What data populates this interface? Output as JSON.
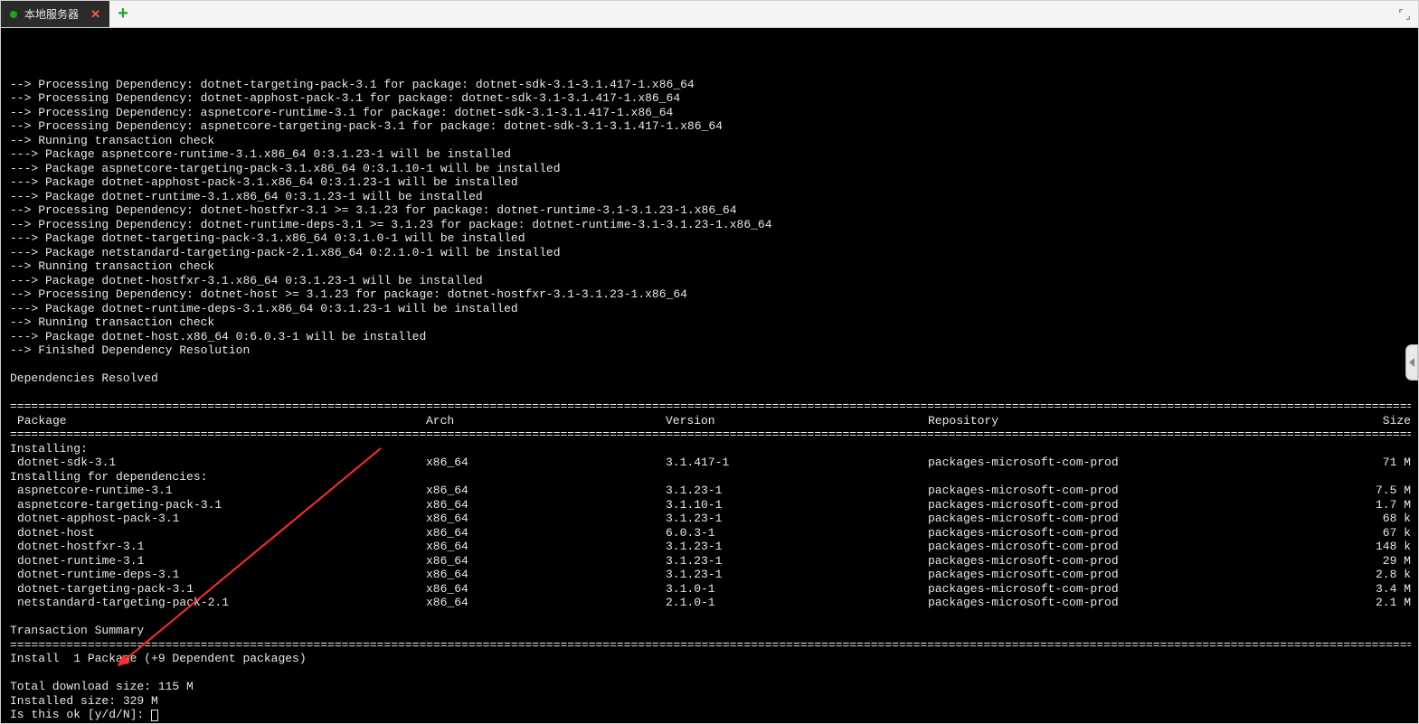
{
  "tab": {
    "title": "本地服务器"
  },
  "terminal": {
    "pre_lines": [
      "--> Processing Dependency: dotnet-targeting-pack-3.1 for package: dotnet-sdk-3.1-3.1.417-1.x86_64",
      "--> Processing Dependency: dotnet-apphost-pack-3.1 for package: dotnet-sdk-3.1-3.1.417-1.x86_64",
      "--> Processing Dependency: aspnetcore-runtime-3.1 for package: dotnet-sdk-3.1-3.1.417-1.x86_64",
      "--> Processing Dependency: aspnetcore-targeting-pack-3.1 for package: dotnet-sdk-3.1-3.1.417-1.x86_64",
      "--> Running transaction check",
      "---> Package aspnetcore-runtime-3.1.x86_64 0:3.1.23-1 will be installed",
      "---> Package aspnetcore-targeting-pack-3.1.x86_64 0:3.1.10-1 will be installed",
      "---> Package dotnet-apphost-pack-3.1.x86_64 0:3.1.23-1 will be installed",
      "---> Package dotnet-runtime-3.1.x86_64 0:3.1.23-1 will be installed",
      "--> Processing Dependency: dotnet-hostfxr-3.1 >= 3.1.23 for package: dotnet-runtime-3.1-3.1.23-1.x86_64",
      "--> Processing Dependency: dotnet-runtime-deps-3.1 >= 3.1.23 for package: dotnet-runtime-3.1-3.1.23-1.x86_64",
      "---> Package dotnet-targeting-pack-3.1.x86_64 0:3.1.0-1 will be installed",
      "---> Package netstandard-targeting-pack-2.1.x86_64 0:2.1.0-1 will be installed",
      "--> Running transaction check",
      "---> Package dotnet-hostfxr-3.1.x86_64 0:3.1.23-1 will be installed",
      "--> Processing Dependency: dotnet-host >= 3.1.23 for package: dotnet-hostfxr-3.1-3.1.23-1.x86_64",
      "---> Package dotnet-runtime-deps-3.1.x86_64 0:3.1.23-1 will be installed",
      "--> Running transaction check",
      "---> Package dotnet-host.x86_64 0:6.0.3-1 will be installed",
      "--> Finished Dependency Resolution",
      "",
      "Dependencies Resolved",
      ""
    ],
    "headers": {
      "package": "Package",
      "arch": "Arch",
      "version": "Version",
      "repository": "Repository",
      "size": "Size"
    },
    "section_installing": "Installing:",
    "section_installing_deps": "Installing for dependencies:",
    "main_package": {
      "name": "dotnet-sdk-3.1",
      "arch": "x86_64",
      "version": "3.1.417-1",
      "repo": "packages-microsoft-com-prod",
      "size": "71 M"
    },
    "dep_packages": [
      {
        "name": "aspnetcore-runtime-3.1",
        "arch": "x86_64",
        "version": "3.1.23-1",
        "repo": "packages-microsoft-com-prod",
        "size": "7.5 M"
      },
      {
        "name": "aspnetcore-targeting-pack-3.1",
        "arch": "x86_64",
        "version": "3.1.10-1",
        "repo": "packages-microsoft-com-prod",
        "size": "1.7 M"
      },
      {
        "name": "dotnet-apphost-pack-3.1",
        "arch": "x86_64",
        "version": "3.1.23-1",
        "repo": "packages-microsoft-com-prod",
        "size": "68 k"
      },
      {
        "name": "dotnet-host",
        "arch": "x86_64",
        "version": "6.0.3-1",
        "repo": "packages-microsoft-com-prod",
        "size": "67 k"
      },
      {
        "name": "dotnet-hostfxr-3.1",
        "arch": "x86_64",
        "version": "3.1.23-1",
        "repo": "packages-microsoft-com-prod",
        "size": "148 k"
      },
      {
        "name": "dotnet-runtime-3.1",
        "arch": "x86_64",
        "version": "3.1.23-1",
        "repo": "packages-microsoft-com-prod",
        "size": "29 M"
      },
      {
        "name": "dotnet-runtime-deps-3.1",
        "arch": "x86_64",
        "version": "3.1.23-1",
        "repo": "packages-microsoft-com-prod",
        "size": "2.8 k"
      },
      {
        "name": "dotnet-targeting-pack-3.1",
        "arch": "x86_64",
        "version": "3.1.0-1",
        "repo": "packages-microsoft-com-prod",
        "size": "3.4 M"
      },
      {
        "name": "netstandard-targeting-pack-2.1",
        "arch": "x86_64",
        "version": "2.1.0-1",
        "repo": "packages-microsoft-com-prod",
        "size": "2.1 M"
      }
    ],
    "transaction_summary": "Transaction Summary",
    "install_line": "Install  1 Package (+9 Dependent packages)",
    "total_download": "Total download size: 115 M",
    "installed_size": "Installed size: 329 M",
    "prompt": "Is this ok [y/d/N]: "
  }
}
